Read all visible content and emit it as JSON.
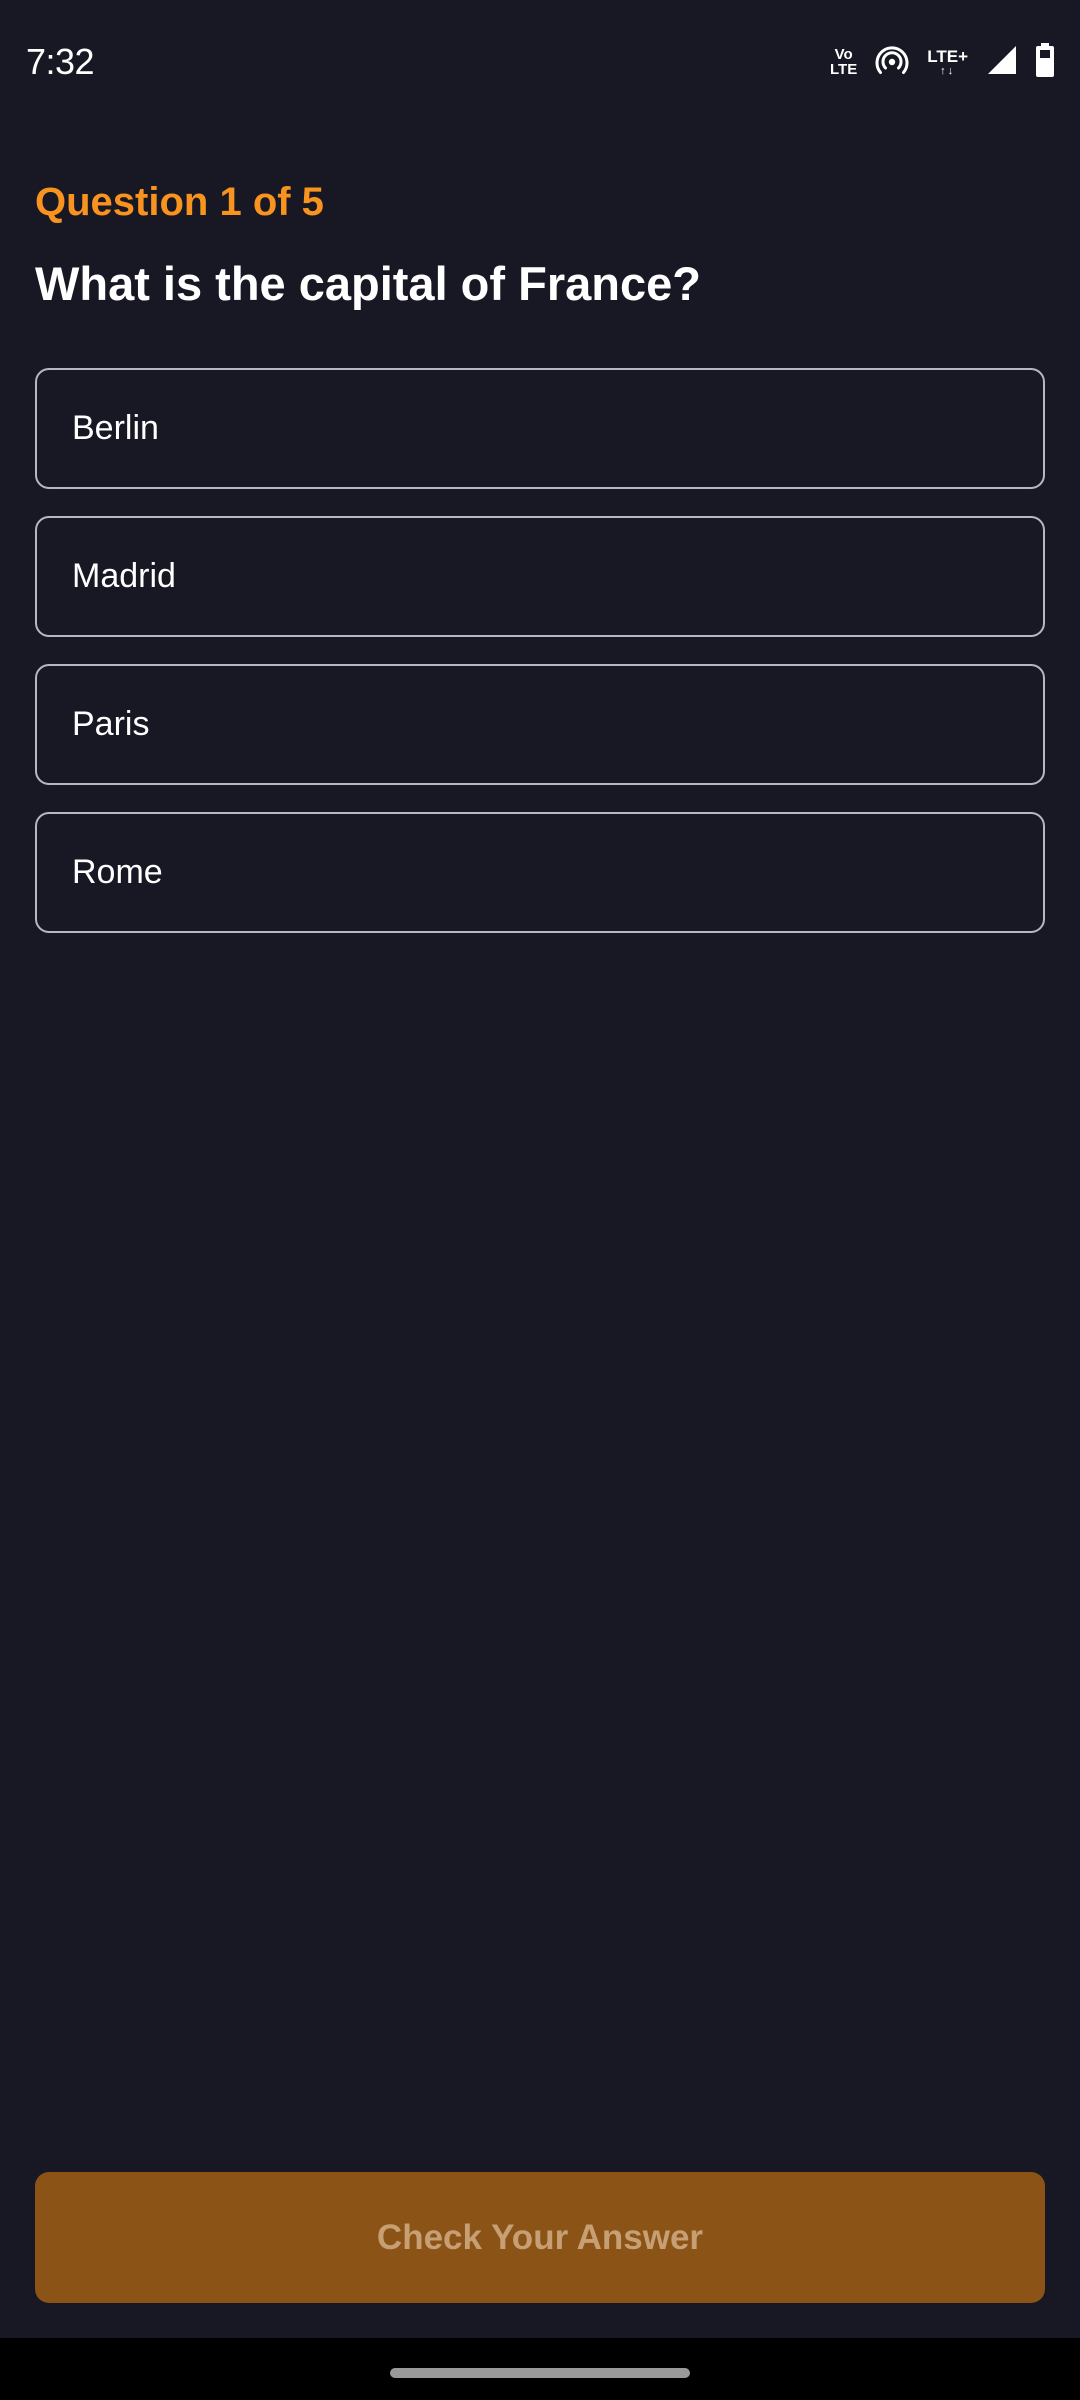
{
  "status_bar": {
    "time": "7:32",
    "volte_top": "Vo",
    "volte_bottom": "LTE",
    "network_label": "LTE+",
    "network_arrows": "↑↓",
    "icons": [
      "volte-icon",
      "hotspot-icon",
      "lte-plus-icon",
      "signal-icon",
      "battery-icon"
    ]
  },
  "quiz": {
    "counter": "Question 1 of 5",
    "question": "What is the capital of France?",
    "options": [
      "Berlin",
      "Madrid",
      "Paris",
      "Rome"
    ],
    "check_button_label": "Check Your Answer"
  },
  "colors": {
    "background": "#181824",
    "accent": "#f7931e",
    "button_disabled": "#8b5315",
    "button_text_disabled": "#c79f74",
    "option_border": "#b7b7c4"
  }
}
